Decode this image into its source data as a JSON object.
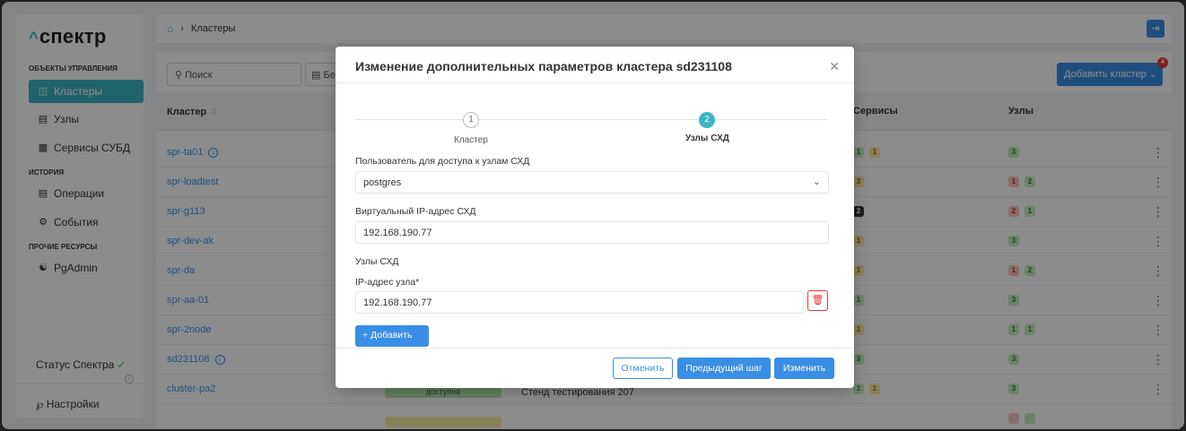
{
  "app": {
    "logo": "спектр"
  },
  "sidebar": {
    "sections": [
      {
        "title": "ОБЪЕКТЫ УПРАВЛЕНИЯ"
      },
      {
        "title": "ИСТОРИЯ"
      },
      {
        "title": "ПРОЧИЕ РЕСУРСЫ"
      }
    ],
    "items": [
      {
        "label": "Кластеры",
        "icon": "clusters-icon",
        "active": true
      },
      {
        "label": "Узлы",
        "icon": "nodes-icon"
      },
      {
        "label": "Сервисы СУБД",
        "icon": "db-services-icon"
      },
      {
        "label": "Операции",
        "icon": "operations-icon"
      },
      {
        "label": "События",
        "icon": "events-icon"
      },
      {
        "label": "PgAdmin",
        "icon": "pgadmin-icon"
      }
    ],
    "status": "Статус Спектра",
    "settings": "Настройки"
  },
  "topbar": {
    "breadcrumb": "Кластеры"
  },
  "toolbar": {
    "search_placeholder": "Поиск",
    "filter_label": "Без",
    "add_cluster": "Добавить кластер",
    "badge_count": "4"
  },
  "table": {
    "columns": [
      "Кластер",
      "Сервисы",
      "Узлы"
    ],
    "rows": [
      {
        "name": "spr-ta01",
        "info": true
      },
      {
        "name": "spr-loadtest"
      },
      {
        "name": "spr-g113"
      },
      {
        "name": "spr-dev-ak"
      },
      {
        "name": "spr-da"
      },
      {
        "name": "spr-aa-01"
      },
      {
        "name": "spr-2node"
      },
      {
        "name": "sd231108",
        "info": true
      },
      {
        "name": "cluster-pa2",
        "status": "доступна",
        "description": "Стенд тестирования 207"
      }
    ]
  },
  "modal": {
    "title": "Изменение дополнительных параметров кластера sd231108",
    "steps": [
      {
        "num": "1",
        "label": "Кластер"
      },
      {
        "num": "2",
        "label": "Узлы СХД"
      }
    ],
    "user_label": "Пользователь для доступа к узлам СХД",
    "user_value": "postgres",
    "vip_label": "Виртуальный IP-адрес СХД",
    "vip_value": "192.168.190.77",
    "nodes_label": "Узлы СХД",
    "node_ip_label": "IP-адрес узла*",
    "node_ip_value": "192.168.190.77",
    "add_button": "+ Добавить",
    "cancel": "Отменить",
    "prev": "Предыдущий шаг",
    "submit": "Изменить"
  }
}
